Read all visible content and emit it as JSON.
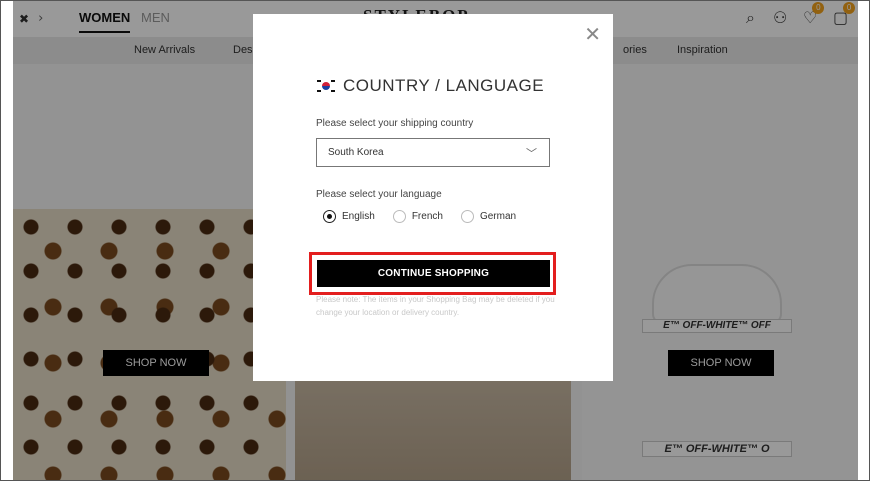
{
  "header": {
    "gender_tabs": [
      "WOMEN",
      "MEN"
    ],
    "logo": "STYLEBOP",
    "wishlist_count": "0",
    "bag_count": "0"
  },
  "nav": {
    "items": [
      "New Arrivals",
      "Des",
      "ories",
      "Inspiration"
    ]
  },
  "content": {
    "shop_now": "SHOP NOW",
    "brand_band": "E™ OFF-WHITE™ OFF",
    "brand_band_bottom": "E™ OFF-WHITE™ O"
  },
  "modal": {
    "title": "COUNTRY / LANGUAGE",
    "country_label": "Please select your shipping country",
    "country_value": "South Korea",
    "language_label": "Please select your language",
    "languages": [
      "English",
      "French",
      "German"
    ],
    "selected_language": "English",
    "cta": "CONTINUE SHOPPING",
    "note": "Please note: The items in your Shopping Bag may be deleted if you change your location or delivery country."
  },
  "colors": {
    "accent_badge": "#f3a21c",
    "highlight": "#e31e1e"
  }
}
